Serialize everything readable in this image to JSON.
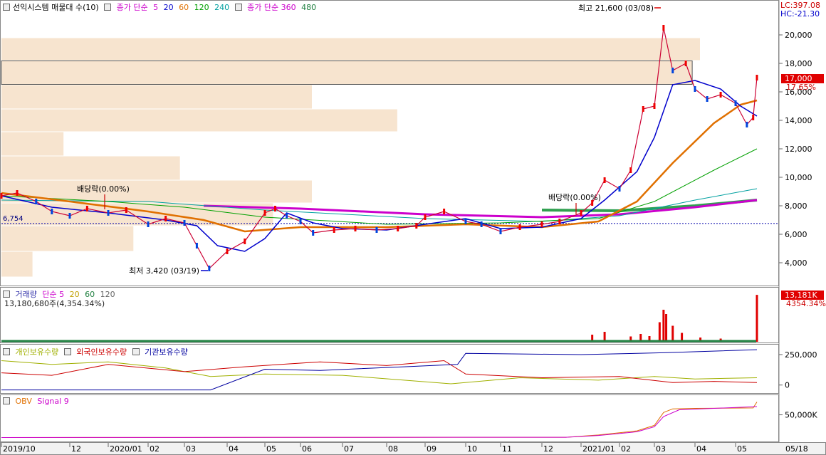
{
  "chart_data": [
    {
      "type": "line",
      "panel": "price",
      "title": "선익시스템 매물대 수(10)",
      "legend": [
        {
          "text": "종가 단순",
          "color": "#cc00cc"
        },
        {
          "text": "5",
          "color": "#cc00cc"
        },
        {
          "text": "20",
          "color": "#0000cc"
        },
        {
          "text": "60",
          "color": "#e07000"
        },
        {
          "text": "120",
          "color": "#00a000"
        },
        {
          "text": "240",
          "color": "#00a0a0"
        },
        {
          "text": "종가 단순 360",
          "color": "#cc00cc"
        },
        {
          "text": "480",
          "color": "#208040"
        }
      ],
      "y_ticks": [
        "20,000",
        "18,000",
        "16,000",
        "14,000",
        "12,000",
        "10,000",
        "8,000",
        "6,000",
        "4,000"
      ],
      "ylim": [
        3000,
        22000
      ],
      "lc_label": "LC:397.08",
      "hc_label": "HC:-21.30",
      "current_price": {
        "value": "17,000",
        "change": "17.65%"
      },
      "reference_line": {
        "value": 6754,
        "label": "6,754"
      },
      "annotations": [
        {
          "text": "최고 21,600 (03/08)",
          "price": 21600
        },
        {
          "text": "최저 3,420 (03/19)",
          "price": 3420
        },
        {
          "text": "배당락(0.00%)"
        },
        {
          "text": "배당락(0.00%)"
        }
      ],
      "volume_profile": [
        {
          "from": 3000,
          "to": 4800,
          "length": 0.04
        },
        {
          "from": 4800,
          "to": 6600,
          "length": 0.17
        },
        {
          "from": 6600,
          "to": 8200,
          "length": 0.35
        },
        {
          "from": 8200,
          "to": 9800,
          "length": 0.4
        },
        {
          "from": 9800,
          "to": 11500,
          "length": 0.23
        },
        {
          "from": 11500,
          "to": 13200,
          "length": 0.08
        },
        {
          "from": 13200,
          "to": 14800,
          "length": 0.51
        },
        {
          "from": 14800,
          "to": 16500,
          "length": 0.4
        },
        {
          "from": 16500,
          "to": 18200,
          "length": 0.89
        },
        {
          "from": 18200,
          "to": 19800,
          "length": 0.9
        }
      ],
      "series_close": [
        [
          "2019-10-01",
          8700
        ],
        [
          "2019-10-15",
          8900
        ],
        [
          "2019-11-01",
          8300
        ],
        [
          "2019-11-15",
          7600
        ],
        [
          "2019-12-01",
          7300
        ],
        [
          "2019-12-15",
          7800
        ],
        [
          "2020-01-01",
          7500
        ],
        [
          "2020-01-15",
          7700
        ],
        [
          "2020-02-01",
          6700
        ],
        [
          "2020-02-15",
          7100
        ],
        [
          "2020-03-01",
          6800
        ],
        [
          "2020-03-10",
          5200
        ],
        [
          "2020-03-19",
          3600
        ],
        [
          "2020-04-01",
          4800
        ],
        [
          "2020-04-15",
          5500
        ],
        [
          "2020-05-01",
          7500
        ],
        [
          "2020-05-10",
          7800
        ],
        [
          "2020-05-20",
          7300
        ],
        [
          "2020-06-01",
          6900
        ],
        [
          "2020-06-10",
          6100
        ],
        [
          "2020-06-25",
          6300
        ],
        [
          "2020-07-10",
          6400
        ],
        [
          "2020-07-25",
          6300
        ],
        [
          "2020-08-10",
          6400
        ],
        [
          "2020-08-25",
          6600
        ],
        [
          "2020-09-01",
          7200
        ],
        [
          "2020-09-15",
          7600
        ],
        [
          "2020-10-01",
          6900
        ],
        [
          "2020-10-15",
          6700
        ],
        [
          "2020-11-01",
          6200
        ],
        [
          "2020-11-15",
          6500
        ],
        [
          "2020-12-01",
          6700
        ],
        [
          "2020-12-15",
          6900
        ],
        [
          "2021-01-01",
          7500
        ],
        [
          "2021-01-10",
          8200
        ],
        [
          "2021-01-20",
          9800
        ],
        [
          "2021-02-01",
          9200
        ],
        [
          "2021-02-10",
          10500
        ],
        [
          "2021-02-20",
          14800
        ],
        [
          "2021-03-01",
          15000
        ],
        [
          "2021-03-08",
          20500
        ],
        [
          "2021-03-15",
          17500
        ],
        [
          "2021-03-25",
          18000
        ],
        [
          "2021-04-01",
          16200
        ],
        [
          "2021-04-10",
          15500
        ],
        [
          "2021-04-20",
          15800
        ],
        [
          "2021-05-01",
          15200
        ],
        [
          "2021-05-10",
          13700
        ],
        [
          "2021-05-15",
          14200
        ],
        [
          "2021-05-18",
          17000
        ]
      ],
      "series_ma20": [
        [
          "2019-10-01",
          8700
        ],
        [
          "2019-11-15",
          7900
        ],
        [
          "2020-01-01",
          7500
        ],
        [
          "2020-02-15",
          7000
        ],
        [
          "2020-03-10",
          6600
        ],
        [
          "2020-03-25",
          5200
        ],
        [
          "2020-04-15",
          4800
        ],
        [
          "2020-05-01",
          5700
        ],
        [
          "2020-05-20",
          7500
        ],
        [
          "2020-06-10",
          6800
        ],
        [
          "2020-07-01",
          6400
        ],
        [
          "2020-08-01",
          6300
        ],
        [
          "2020-09-01",
          6700
        ],
        [
          "2020-10-01",
          7100
        ],
        [
          "2020-11-01",
          6400
        ],
        [
          "2020-12-01",
          6500
        ],
        [
          "2021-01-01",
          7100
        ],
        [
          "2021-01-20",
          8400
        ],
        [
          "2021-02-15",
          10400
        ],
        [
          "2021-03-01",
          12800
        ],
        [
          "2021-03-15",
          16500
        ],
        [
          "2021-04-01",
          16800
        ],
        [
          "2021-04-20",
          16200
        ],
        [
          "2021-05-05",
          15000
        ],
        [
          "2021-05-18",
          14300
        ]
      ],
      "series_ma60": [
        [
          "2019-10-01",
          8900
        ],
        [
          "2019-12-01",
          8300
        ],
        [
          "2020-02-01",
          7600
        ],
        [
          "2020-03-15",
          7000
        ],
        [
          "2020-04-15",
          6200
        ],
        [
          "2020-06-01",
          6500
        ],
        [
          "2020-08-01",
          6500
        ],
        [
          "2020-10-01",
          6700
        ],
        [
          "2020-12-01",
          6500
        ],
        [
          "2021-01-15",
          6900
        ],
        [
          "2021-02-15",
          8300
        ],
        [
          "2021-03-15",
          11000
        ],
        [
          "2021-04-15",
          13800
        ],
        [
          "2021-05-05",
          15100
        ],
        [
          "2021-05-18",
          15400
        ]
      ],
      "series_ma120": [
        [
          "2019-10-01",
          8700
        ],
        [
          "2020-01-01",
          8300
        ],
        [
          "2020-03-01",
          7900
        ],
        [
          "2020-05-01",
          7200
        ],
        [
          "2020-08-01",
          6700
        ],
        [
          "2020-11-01",
          6800
        ],
        [
          "2021-01-15",
          7100
        ],
        [
          "2021-03-01",
          8300
        ],
        [
          "2021-04-15",
          10500
        ],
        [
          "2021-05-18",
          12000
        ]
      ],
      "series_ma240": [
        [
          "2019-10-01",
          8400
        ],
        [
          "2020-02-01",
          8300
        ],
        [
          "2020-05-01",
          7700
        ],
        [
          "2020-09-01",
          7100
        ],
        [
          "2020-12-01",
          6900
        ],
        [
          "2021-02-01",
          7300
        ],
        [
          "2021-04-01",
          8400
        ],
        [
          "2021-05-18",
          9200
        ]
      ],
      "series_ma360": [
        [
          "2020-03-15",
          8000
        ],
        [
          "2020-06-01",
          7800
        ],
        [
          "2020-09-01",
          7400
        ],
        [
          "2020-12-01",
          7200
        ],
        [
          "2021-02-01",
          7400
        ],
        [
          "2021-04-01",
          7900
        ],
        [
          "2021-05-18",
          8400
        ]
      ],
      "series_ma480": [
        [
          "2020-12-01",
          7700
        ],
        [
          "2021-02-01",
          7650
        ],
        [
          "2021-04-01",
          8000
        ],
        [
          "2021-05-18",
          8400
        ]
      ]
    },
    {
      "type": "bar",
      "panel": "volume",
      "legend": [
        {
          "text": "거래량",
          "color": "#3333aa"
        },
        {
          "text": "단순 5",
          "color": "#cc00cc"
        },
        {
          "text": "20",
          "color": "#c0a000"
        },
        {
          "text": "60",
          "color": "#208040"
        },
        {
          "text": "120",
          "color": "#666666"
        }
      ],
      "sub_label": "13,180,680주(4,354.34%)",
      "current_value": {
        "value": "13,181K",
        "change": "4354.34%"
      },
      "bars": [
        [
          "2019-10-15",
          0.3
        ],
        [
          "2020-01-20",
          0.2
        ],
        [
          "2020-03-19",
          0.4
        ],
        [
          "2020-05-05",
          0.5
        ],
        [
          "2020-09-10",
          0.3
        ],
        [
          "2021-01-10",
          2.0
        ],
        [
          "2021-01-20",
          2.8
        ],
        [
          "2021-02-10",
          1.5
        ],
        [
          "2021-02-18",
          2.2
        ],
        [
          "2021-02-25",
          1.6
        ],
        [
          "2021-03-05",
          5.5
        ],
        [
          "2021-03-08",
          9.0
        ],
        [
          "2021-03-10",
          7.8
        ],
        [
          "2021-03-15",
          4.5
        ],
        [
          "2021-03-22",
          2.5
        ],
        [
          "2021-04-05",
          1.2
        ],
        [
          "2021-04-20",
          0.9
        ],
        [
          "2021-05-18",
          13.18
        ]
      ],
      "ylim": [
        0,
        14
      ]
    },
    {
      "type": "line",
      "panel": "holdings",
      "legend": [
        {
          "text": "개인보유수량",
          "color": "#a0b000"
        },
        {
          "text": "외국인보유수량",
          "color": "#cc0000"
        },
        {
          "text": "기관보유수량",
          "color": "#0000a0"
        }
      ],
      "y_ticks": [
        "250,000",
        "0"
      ],
      "ylim": [
        -60000,
        320000
      ],
      "series": [
        {
          "name": "개인보유수량",
          "color": "#a0b000",
          "points": [
            [
              "2019-10-01",
              200000
            ],
            [
              "2019-11-15",
              170000
            ],
            [
              "2020-01-01",
              190000
            ],
            [
              "2020-02-15",
              140000
            ],
            [
              "2020-03-20",
              70000
            ],
            [
              "2020-05-01",
              90000
            ],
            [
              "2020-07-01",
              80000
            ],
            [
              "2020-08-15",
              40000
            ],
            [
              "2020-09-20",
              10000
            ],
            [
              "2020-11-15",
              60000
            ],
            [
              "2021-01-15",
              40000
            ],
            [
              "2021-03-01",
              70000
            ],
            [
              "2021-04-01",
              50000
            ],
            [
              "2021-05-18",
              60000
            ]
          ]
        },
        {
          "name": "외국인보유수량",
          "color": "#cc0000",
          "points": [
            [
              "2019-10-01",
              100000
            ],
            [
              "2019-11-15",
              80000
            ],
            [
              "2020-01-01",
              170000
            ],
            [
              "2020-03-01",
              110000
            ],
            [
              "2020-04-15",
              150000
            ],
            [
              "2020-06-15",
              190000
            ],
            [
              "2020-08-01",
              160000
            ],
            [
              "2020-09-15",
              200000
            ],
            [
              "2020-10-01",
              90000
            ],
            [
              "2020-12-01",
              60000
            ],
            [
              "2021-02-01",
              70000
            ],
            [
              "2021-03-15",
              20000
            ],
            [
              "2021-04-15",
              30000
            ],
            [
              "2021-05-18",
              20000
            ]
          ]
        },
        {
          "name": "기관보유수량",
          "color": "#0000a0",
          "points": [
            [
              "2019-10-01",
              -40000
            ],
            [
              "2020-01-01",
              -40000
            ],
            [
              "2020-03-20",
              -40000
            ],
            [
              "2020-05-01",
              130000
            ],
            [
              "2020-06-15",
              120000
            ],
            [
              "2020-08-15",
              150000
            ],
            [
              "2020-09-25",
              170000
            ],
            [
              "2020-10-01",
              260000
            ],
            [
              "2021-01-01",
              250000
            ],
            [
              "2021-03-08",
              265000
            ],
            [
              "2021-05-18",
              290000
            ]
          ]
        }
      ]
    },
    {
      "type": "line",
      "panel": "obv",
      "legend": [
        {
          "text": "OBV",
          "color": "#e07000"
        },
        {
          "text": "Signal 9",
          "color": "#cc00cc"
        }
      ],
      "y_ticks": [
        "50,000K"
      ],
      "ylim": [
        -5000,
        85000
      ],
      "series": [
        {
          "name": "OBV",
          "color": "#e07000",
          "points": [
            [
              "2019-10-01",
              500
            ],
            [
              "2020-12-20",
              1000
            ],
            [
              "2021-01-15",
              6000
            ],
            [
              "2021-02-15",
              15000
            ],
            [
              "2021-03-01",
              27000
            ],
            [
              "2021-03-08",
              55000
            ],
            [
              "2021-03-15",
              63000
            ],
            [
              "2021-04-01",
              64000
            ],
            [
              "2021-05-15",
              65000
            ],
            [
              "2021-05-18",
              78000
            ]
          ]
        },
        {
          "name": "Signal 9",
          "color": "#cc00cc",
          "points": [
            [
              "2019-10-01",
              500
            ],
            [
              "2020-12-20",
              1000
            ],
            [
              "2021-01-15",
              5000
            ],
            [
              "2021-02-15",
              13000
            ],
            [
              "2021-03-01",
              24000
            ],
            [
              "2021-03-08",
              46000
            ],
            [
              "2021-03-20",
              61000
            ],
            [
              "2021-04-15",
              64000
            ],
            [
              "2021-05-18",
              68000
            ]
          ]
        }
      ]
    }
  ],
  "x_axis": {
    "labels": [
      {
        "text": "2019/10",
        "date": "2019-10-01"
      },
      {
        "text": "12",
        "date": "2019-12-01"
      },
      {
        "text": "2020/01",
        "date": "2020-01-01"
      },
      {
        "text": "02",
        "date": "2020-02-01"
      },
      {
        "text": "03",
        "date": "2020-03-01"
      },
      {
        "text": "04",
        "date": "2020-04-01"
      },
      {
        "text": "05",
        "date": "2020-05-01"
      },
      {
        "text": "06",
        "date": "2020-06-01"
      },
      {
        "text": "07",
        "date": "2020-07-01"
      },
      {
        "text": "08",
        "date": "2020-08-01"
      },
      {
        "text": "09",
        "date": "2020-09-01"
      },
      {
        "text": "10",
        "date": "2020-10-01"
      },
      {
        "text": "11",
        "date": "2020-11-01"
      },
      {
        "text": "12",
        "date": "2020-12-01"
      },
      {
        "text": "2021/01",
        "date": "2021-01-01"
      },
      {
        "text": "02",
        "date": "2021-02-01"
      },
      {
        "text": "03",
        "date": "2021-03-01"
      },
      {
        "text": "04",
        "date": "2021-04-01"
      },
      {
        "text": "05",
        "date": "2021-05-01"
      }
    ],
    "last_label": "05/18"
  }
}
